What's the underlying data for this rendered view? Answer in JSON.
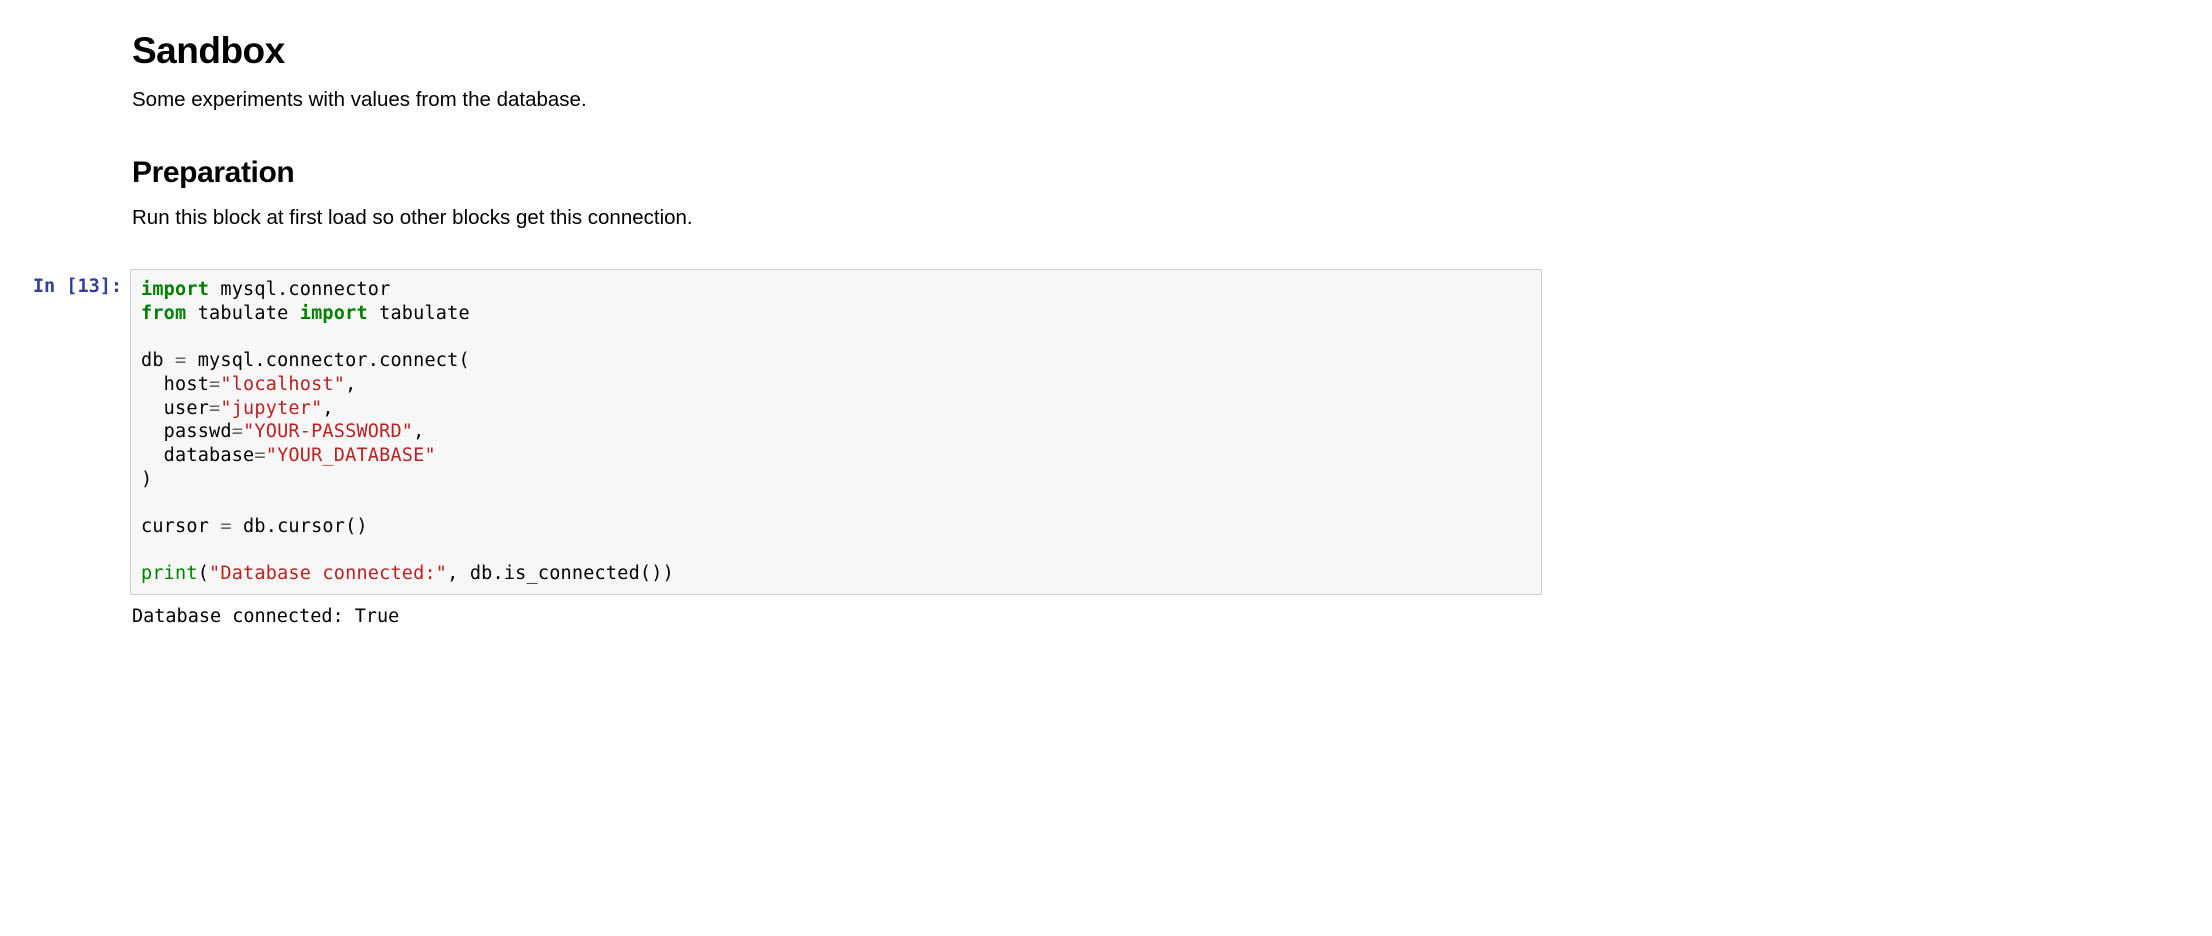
{
  "markdown": {
    "h1": "Sandbox",
    "p1": "Some experiments with values from the database.",
    "h2": "Preparation",
    "p2": "Run this block at first load so other blocks get this connection."
  },
  "code_cell": {
    "prompt_prefix": "In [",
    "prompt_exec": "13",
    "prompt_suffix": "]:",
    "tokens": {
      "kw_import1": "import",
      "mod_mysql": " mysql.connector",
      "nl1": "\n",
      "kw_from": "from",
      "mod_tab": " tabulate ",
      "kw_import2": "import",
      "name_tab": " tabulate",
      "nl2": "\n\n",
      "name_db": "db ",
      "op_eq1": "=",
      "conn_call": " mysql.connector.connect(",
      "nl3": "\n  host",
      "op_eq2": "=",
      "str_host": "\"localhost\"",
      "comma1": ",",
      "nl4": "\n  user",
      "op_eq3": "=",
      "str_user": "\"jupyter\"",
      "comma2": ",",
      "nl5": "\n  passwd",
      "op_eq4": "=",
      "str_pass": "\"YOUR-PASSWORD\"",
      "comma3": ",",
      "nl6": "\n  database",
      "op_eq5": "=",
      "str_dbn": "\"YOUR_DATABASE\"",
      "nl7": "\n)",
      "nl8": "\n\n",
      "name_cur": "cursor ",
      "op_eq6": "=",
      "cur_call": " db.cursor()",
      "nl9": "\n\n",
      "bi_print": "print",
      "pr_open": "(",
      "str_msg": "\"Database connected:\"",
      "comma4": ", db.is_connected())"
    },
    "output": "Database connected: True"
  }
}
